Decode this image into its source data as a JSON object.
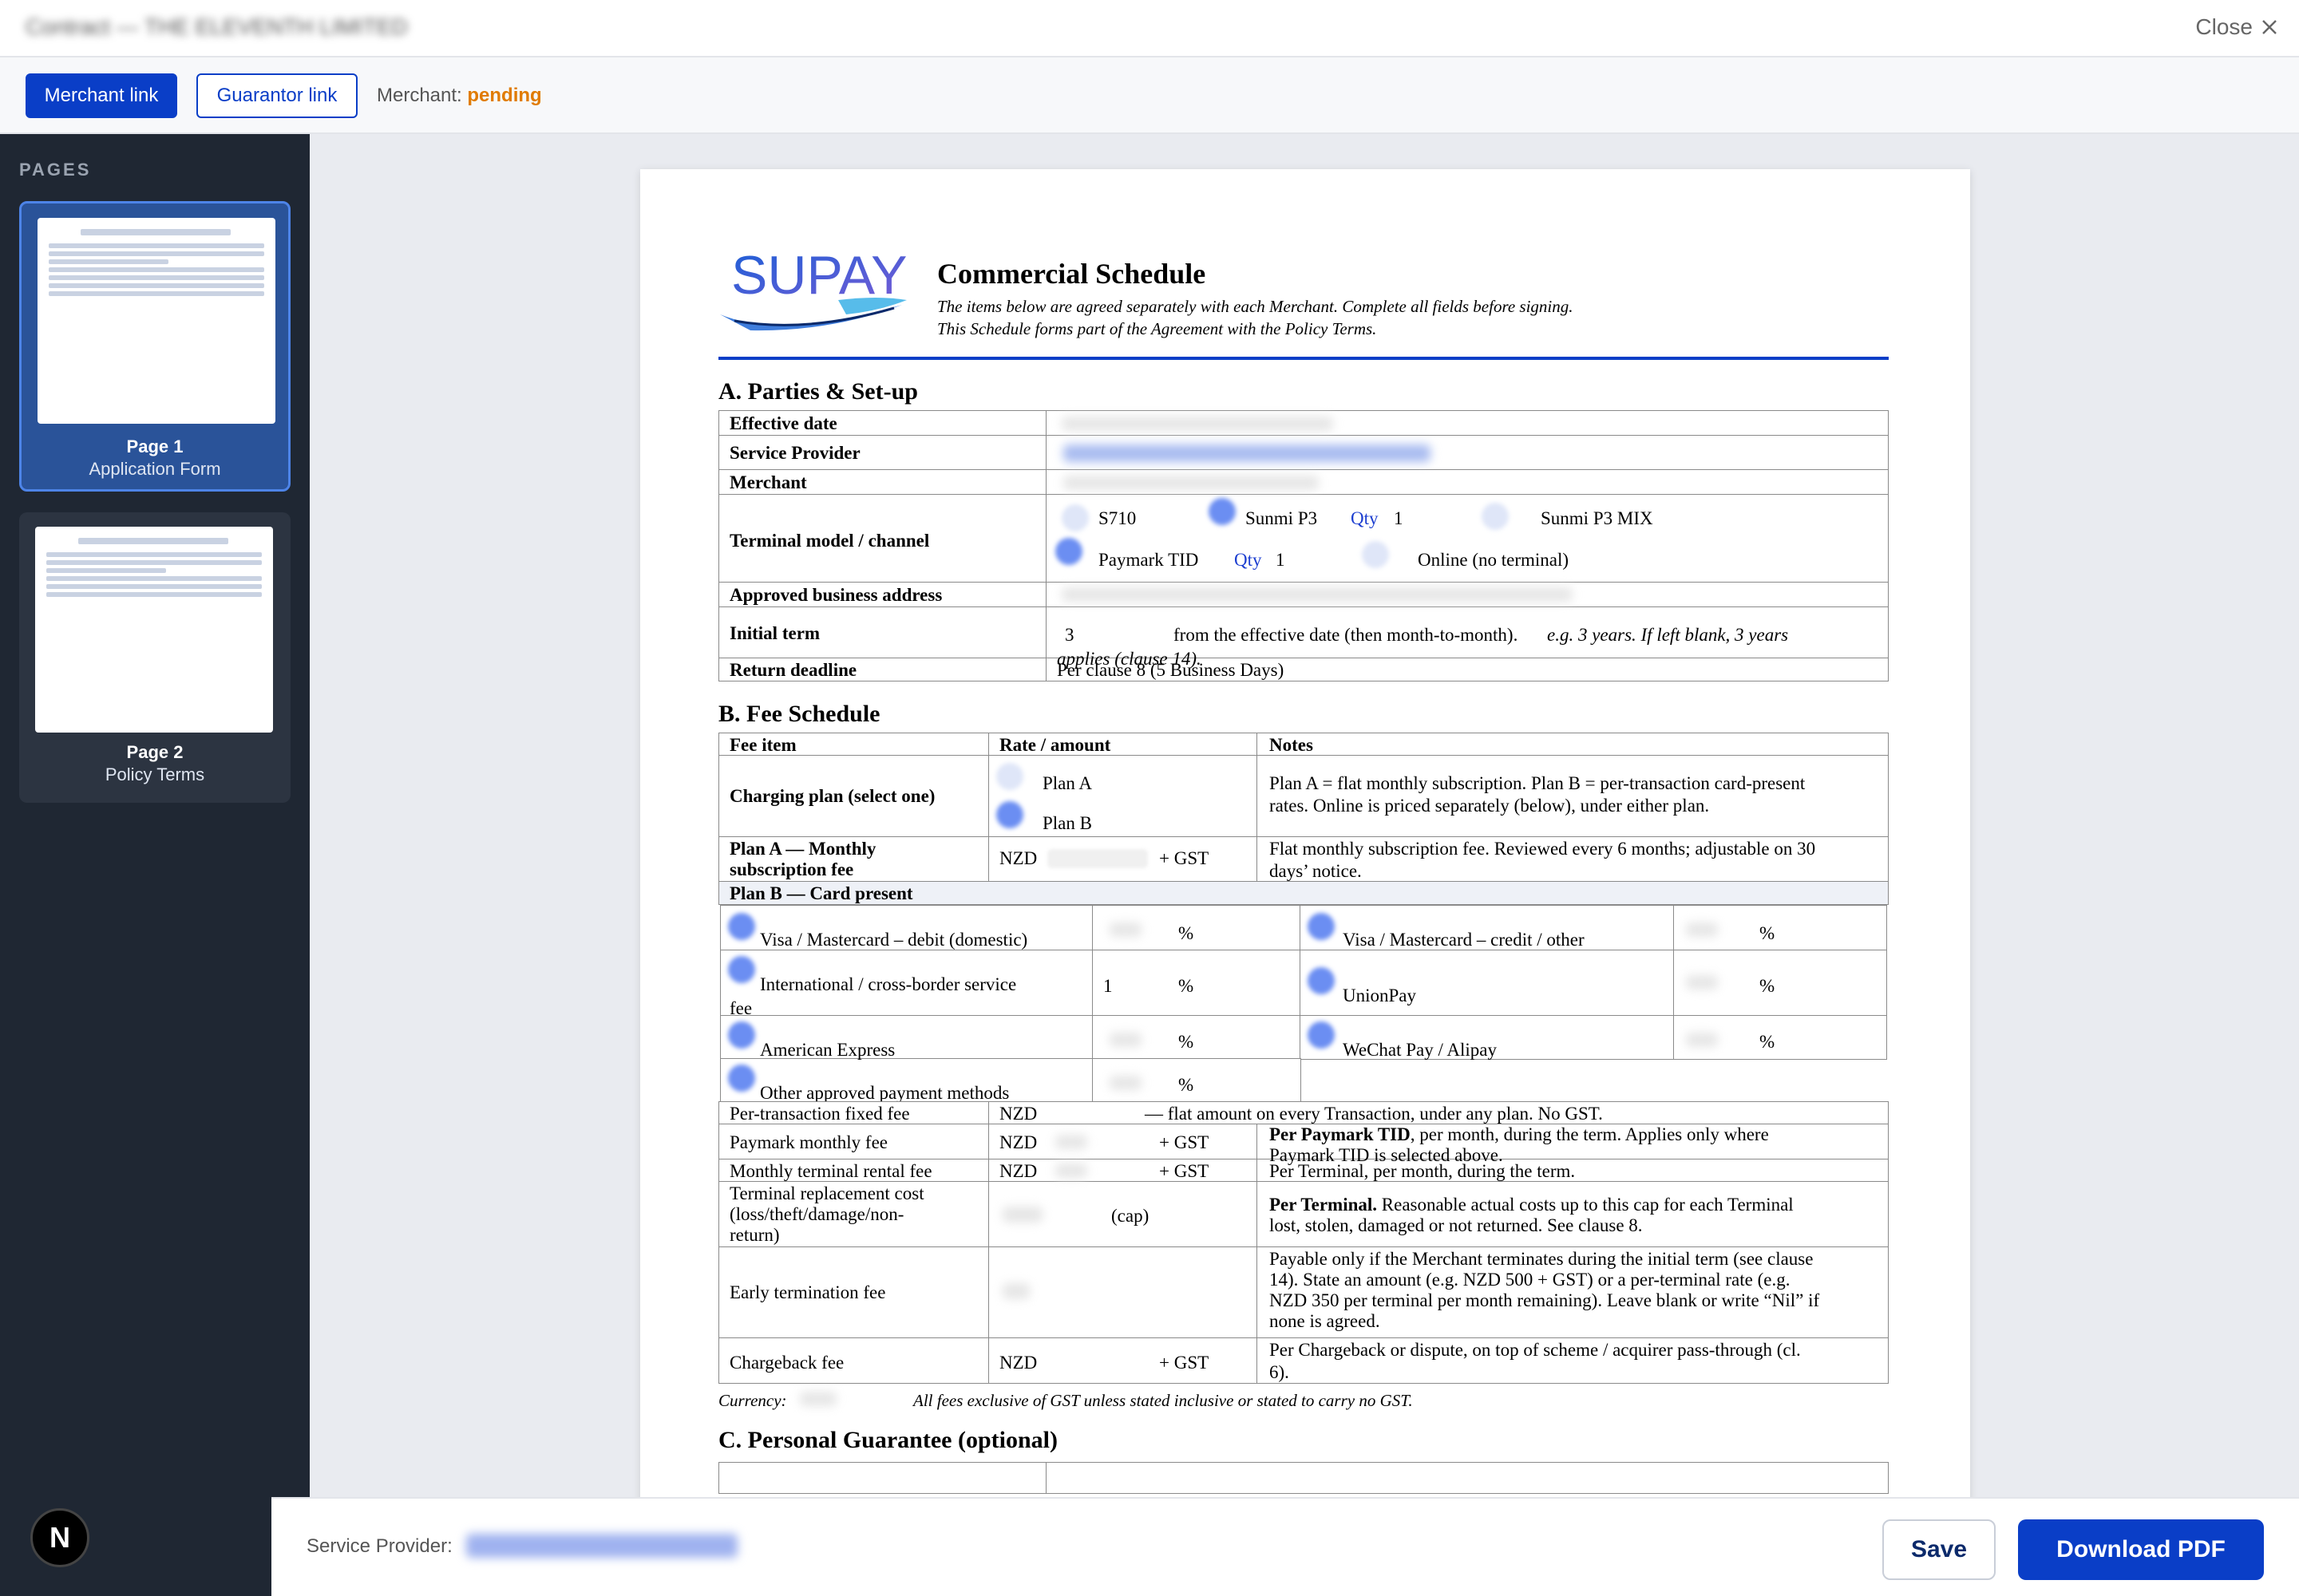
{
  "window": {
    "close_label": "Close",
    "title_blurred": "Contract — THE ELEVENTH LIMITED"
  },
  "toolbar": {
    "merchant_link": "Merchant link",
    "guarantor_link": "Guarantor link",
    "status_label": "Merchant:",
    "status_value": "pending"
  },
  "sidebar": {
    "heading": "PAGES",
    "pages": [
      {
        "num": "Page 1",
        "sub": "Application Form"
      },
      {
        "num": "Page 2",
        "sub": "Policy Terms"
      }
    ],
    "badge": "N"
  },
  "schedule": {
    "title": "Commercial Schedule",
    "note1": "The items below are agreed separately with each Merchant. Complete all fields before signing.",
    "note2": "This Schedule forms part of the Agreement with the Policy Terms.",
    "logo_text": "SUPAY",
    "secA": "A. Parties & Set-up",
    "rowsA": {
      "effective": "Effective date",
      "provider": "Service Provider",
      "merchant": "Merchant",
      "terminal": "Terminal model / channel",
      "address": "Approved business address",
      "term": "Initial term",
      "deadline": "Return deadline"
    },
    "terminal": {
      "s710": "S710",
      "sunmi": "Sunmi P3",
      "qty": "Qty",
      "qty_val": "1",
      "sunmi_mix": "Sunmi P3 MIX",
      "paymark": "Paymark TID",
      "qty2_val": "1",
      "online": "Online (no terminal)"
    },
    "term": {
      "value": "3",
      "text1": "from the effective date (then month-to-month).",
      "text2": "e.g. 3 years. If left blank, 3 years",
      "text3": "applies (clause 14)."
    },
    "deadline_val": "Per clause 8 (5 Business Days)",
    "secB": "B. Fee Schedule",
    "headB": {
      "item": "Fee item",
      "rate": "Rate / amount",
      "notes": "Notes"
    },
    "charging": {
      "label": "Charging plan (select one)",
      "planA": "Plan A",
      "planB": "Plan B",
      "note1": "Plan A = flat monthly subscription. Plan B = per-transaction card-present",
      "note2": "rates. Online is priced separately (below), under either plan."
    },
    "planA": {
      "label1": "Plan A — Monthly",
      "label2": "subscription fee",
      "nzd": "NZD",
      "gst": "+ GST",
      "note1": "Flat monthly subscription fee. Reviewed every 6 months; adjustable on 30",
      "note2": "days’ notice."
    },
    "planB_head": "Plan B — Card present",
    "cards": {
      "visa_debit": "Visa / Mastercard – debit (domestic)",
      "visa_credit": "Visa / Mastercard – credit / other",
      "intl1": "International / cross-border service",
      "intl2": "fee",
      "intl_val": "1",
      "unionpay": "UnionPay",
      "amex": "American Express",
      "wechat": "WeChat Pay / Alipay",
      "other": "Other approved payment methods",
      "pct": "%"
    },
    "fees": {
      "per_tx": "Per-transaction fixed fee",
      "per_tx_note": "— flat amount on every Transaction, under any plan. No GST.",
      "paymark": "Paymark monthly fee",
      "paymark_note_b": "Per Paymark TID",
      "paymark_note1": ", per month, during the term. Applies only where",
      "paymark_note2": "Paymark TID is selected above.",
      "rental": "Monthly terminal rental fee",
      "rental_note": "Per Terminal, per month, during the term.",
      "repl1": "Terminal replacement cost",
      "repl2": "(loss/theft/damage/non-",
      "repl3": "return)",
      "cap": "(cap)",
      "repl_note_b": "Per Terminal.",
      "repl_note1": " Reasonable actual costs up to this cap for each Terminal",
      "repl_note2": "lost, stolen, damaged or not returned. See clause 8.",
      "early": "Early termination fee",
      "early_note1": "Payable only if the Merchant terminates during the initial term (see clause",
      "early_note2": "14). State an amount (e.g. NZD 500 + GST) or a per-terminal rate (e.g.",
      "early_note3": "NZD 350 per terminal per month remaining). Leave blank or write “Nil” if",
      "early_note4": "none is agreed.",
      "chargeback": "Chargeback fee",
      "chargeback_note1": "Per Chargeback or dispute, on top of scheme / acquirer pass-through (cl.",
      "chargeback_note2": "6).",
      "nzd": "NZD",
      "gst": "+ GST"
    },
    "currency_label": "Currency:",
    "currency_note": "All fees exclusive of GST unless stated inclusive or stated to carry no GST.",
    "secC": "C. Personal Guarantee (optional)"
  },
  "bottom": {
    "provider_label": "Service Provider:",
    "save": "Save",
    "download": "Download PDF"
  }
}
